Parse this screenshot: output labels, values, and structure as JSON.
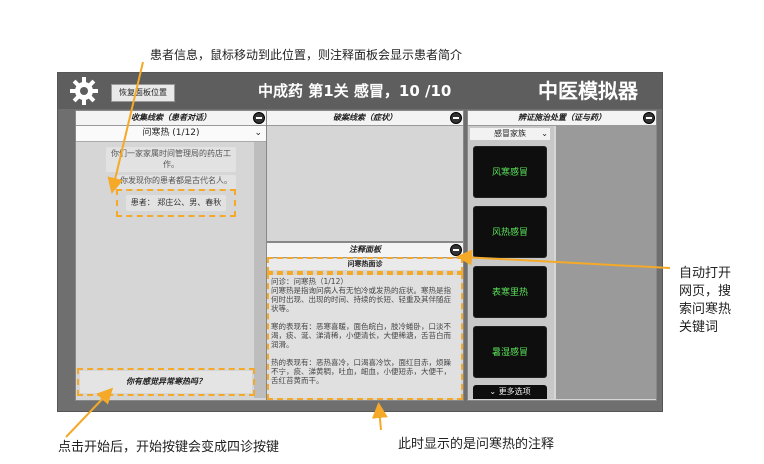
{
  "annotations": {
    "top": "患者信息，鼠标移动到此位置，则注释面板会显示患者简介",
    "right": [
      "自动打开",
      "网页，搜",
      "索问寒热",
      "关键词"
    ],
    "bottom_left": "点击开始后，开始按键会变成四诊按键",
    "bottom_mid": "此时显示的是问寒热的注释"
  },
  "app": {
    "restore_label": "恢复面板位置",
    "title": "中成药  第1关  感冒，10 /10",
    "brand": "中医模拟器"
  },
  "left_panel": {
    "header": "收集线索（患者对话）",
    "dropdown": "问寒热 (1/12)",
    "messages": [
      "你们一家家属时间管理局的药店工作。",
      "你发现你的患者都是古代名人。"
    ],
    "patient": "患者：  郑庄公、男、春秋",
    "start_button": "你有感觉异常寒热吗？"
  },
  "mid_panel": {
    "header": "破案线索（症状）"
  },
  "note_panel": {
    "header": "注释面板",
    "subheader": "问寒热面诊",
    "lines": [
      "问诊：问寒热（1/12）",
      "问寒热是指询问病人有无怕冷或发热的症状。寒热是指",
      "何时出现、出现的时间、持续的长短、轻重及其伴随症",
      "状等。",
      "",
      "寒的表现有：恶寒喜暖，面色皖白，肢冷蜷卧，口淡不",
      "渴，痰、涎、涕清稀，小便清长，大便稀溏，舌苔白而",
      "润滑。",
      "",
      "热的表现有：恶热喜冷，口渴喜冷饮，面红目赤，烦躁",
      "不宁，痰、涕黄稠，吐血，衄血，小便短赤，大便干，",
      "舌红苔黄而干。"
    ]
  },
  "right_panel": {
    "header": "辨证施治处置（证与药）",
    "dropdown": "感冒家族",
    "choices": [
      "风寒感冒",
      "风热感冒",
      "表寒里热",
      "暑湿感冒"
    ],
    "more": "更多选项"
  },
  "colors": {
    "highlight": "#f4a928",
    "choice_text": "#5be35b",
    "choice_bg": "#0e0e0e"
  }
}
